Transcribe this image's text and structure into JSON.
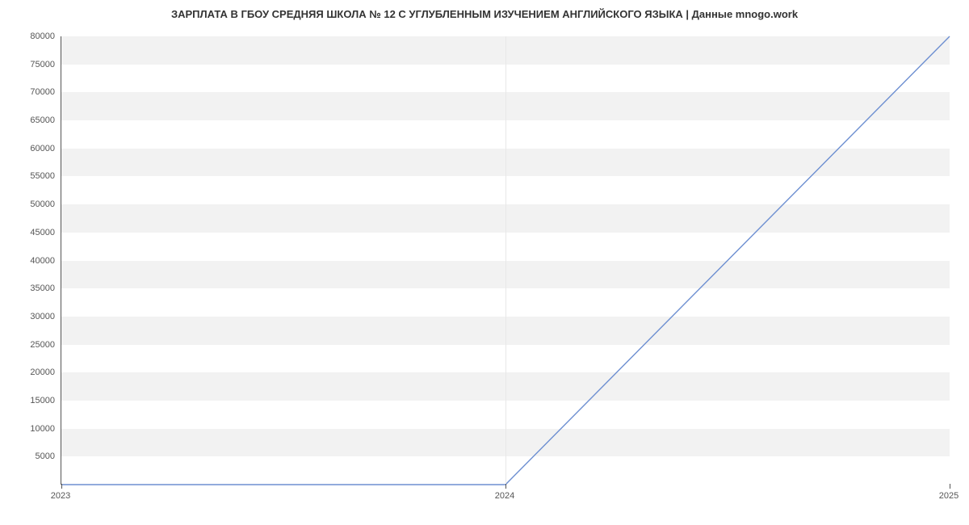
{
  "chart_data": {
    "type": "line",
    "title": "ЗАРПЛАТА В ГБОУ СРЕДНЯЯ ШКОЛА № 12 С УГЛУБЛЕННЫМ ИЗУЧЕНИЕМ АНГЛИЙСКОГО ЯЗЫКА | Данные mnogo.work",
    "x": [
      2023,
      2024,
      2025
    ],
    "values": [
      0,
      0,
      80000
    ],
    "xlabel": "",
    "ylabel": "",
    "ylim": [
      0,
      80000
    ],
    "xlim": [
      2023,
      2025
    ],
    "y_ticks": [
      5000,
      10000,
      15000,
      20000,
      25000,
      30000,
      35000,
      40000,
      45000,
      50000,
      55000,
      60000,
      65000,
      70000,
      75000,
      80000
    ],
    "x_ticks": [
      2023,
      2024,
      2025
    ],
    "series_color": "#6d8fd1"
  }
}
